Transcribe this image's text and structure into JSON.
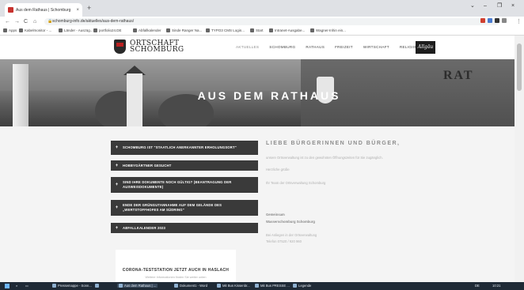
{
  "browser": {
    "tab_title": "Aus dem Rathaus | Schomburg",
    "tab_close": "×",
    "new_tab": "+",
    "win_min": "–",
    "win_restore": "❐",
    "win_close": "×",
    "win_dropdown": "⌄",
    "url": "schomburg-info.de/aktuelles/aus-dem-rathaus/",
    "lock": "🔒",
    "nav_back": "←",
    "nav_forward": "→",
    "nav_reload": "C",
    "nav_home": "⌂",
    "bookmarks": [
      "Apps",
      "Kabelmonitor - ...",
      "Länder - Auszüg...",
      "portfolio24.DE",
      "Abfallkalender",
      "Sinde Ranger Na...",
      "TYPO3 CMS Login...",
      "Start",
      "Intranet-Ausgabe...",
      "Wagner-Inhin ein..."
    ],
    "ext_colors": [
      "#d04030",
      "#4a7bd0",
      "#333333",
      "#888888"
    ]
  },
  "header": {
    "logo_line1": "ORTSCHAFT",
    "logo_line2": "SCHOMBURG",
    "nav": [
      "AKTUELLES",
      "SCHOMBURG",
      "RATHAUS",
      "FREIZEIT",
      "WIRTSCHAFT",
      "RELIGION"
    ],
    "active_nav": "AKTUELLES",
    "brand": "Allgäu"
  },
  "hero": {
    "title": "AUS DEM RATHAUS",
    "sign": "RAT"
  },
  "accordion": {
    "plus": "+",
    "items": [
      "SCHOMBURG IST \"STAATLICH ANERKANNTER ERHOLUNGSORT\"",
      "HOBBYGÄRTNER GESUCHT",
      "SIND IHRE DOKUMENTE NOCH GÜLTIG? (BEANTRAGUNG DER AUSWEISDOKUMENTE)",
      "ENDE DER GRÜNGUTANNAHME AUF DEM GELÄNDE DES „WERTSTOFFHOFES AM SÜDRING\"",
      "ABFALLKALENDER 2023"
    ]
  },
  "article": {
    "heading": "LIEBE BÜRGERINNEN UND BÜRGER,",
    "lines": [
      "unsere Ortsverwaltung ist zu den gewohnten Öffnungszeiten für Sie zugänglich.",
      "Herzliche grüße",
      "Ihr Team der Ortsverwaltung Schomburg",
      "Gemeinsam",
      "Wasserschomburg Schomburg",
      "Bei Anliegen in der Ortsverwaltung",
      "Telefon 07520 / 920 960"
    ]
  },
  "card": {
    "title": "CORONA-TESTSTATION JETZT AUCH IN HASLACH",
    "subtitle": "Weitere Informationen finden Sie weiter unten"
  },
  "taskbar": {
    "items": [
      "Pressemappe - Sonn...",
      "Aus dem Rathaus | ...",
      "Dokument1 - Word",
      "Mit Bus Kissenbr...",
      "Mit Bus PRESSE ...",
      "Legende"
    ],
    "active_index": 1,
    "time": "10:21",
    "lang": "DE"
  }
}
